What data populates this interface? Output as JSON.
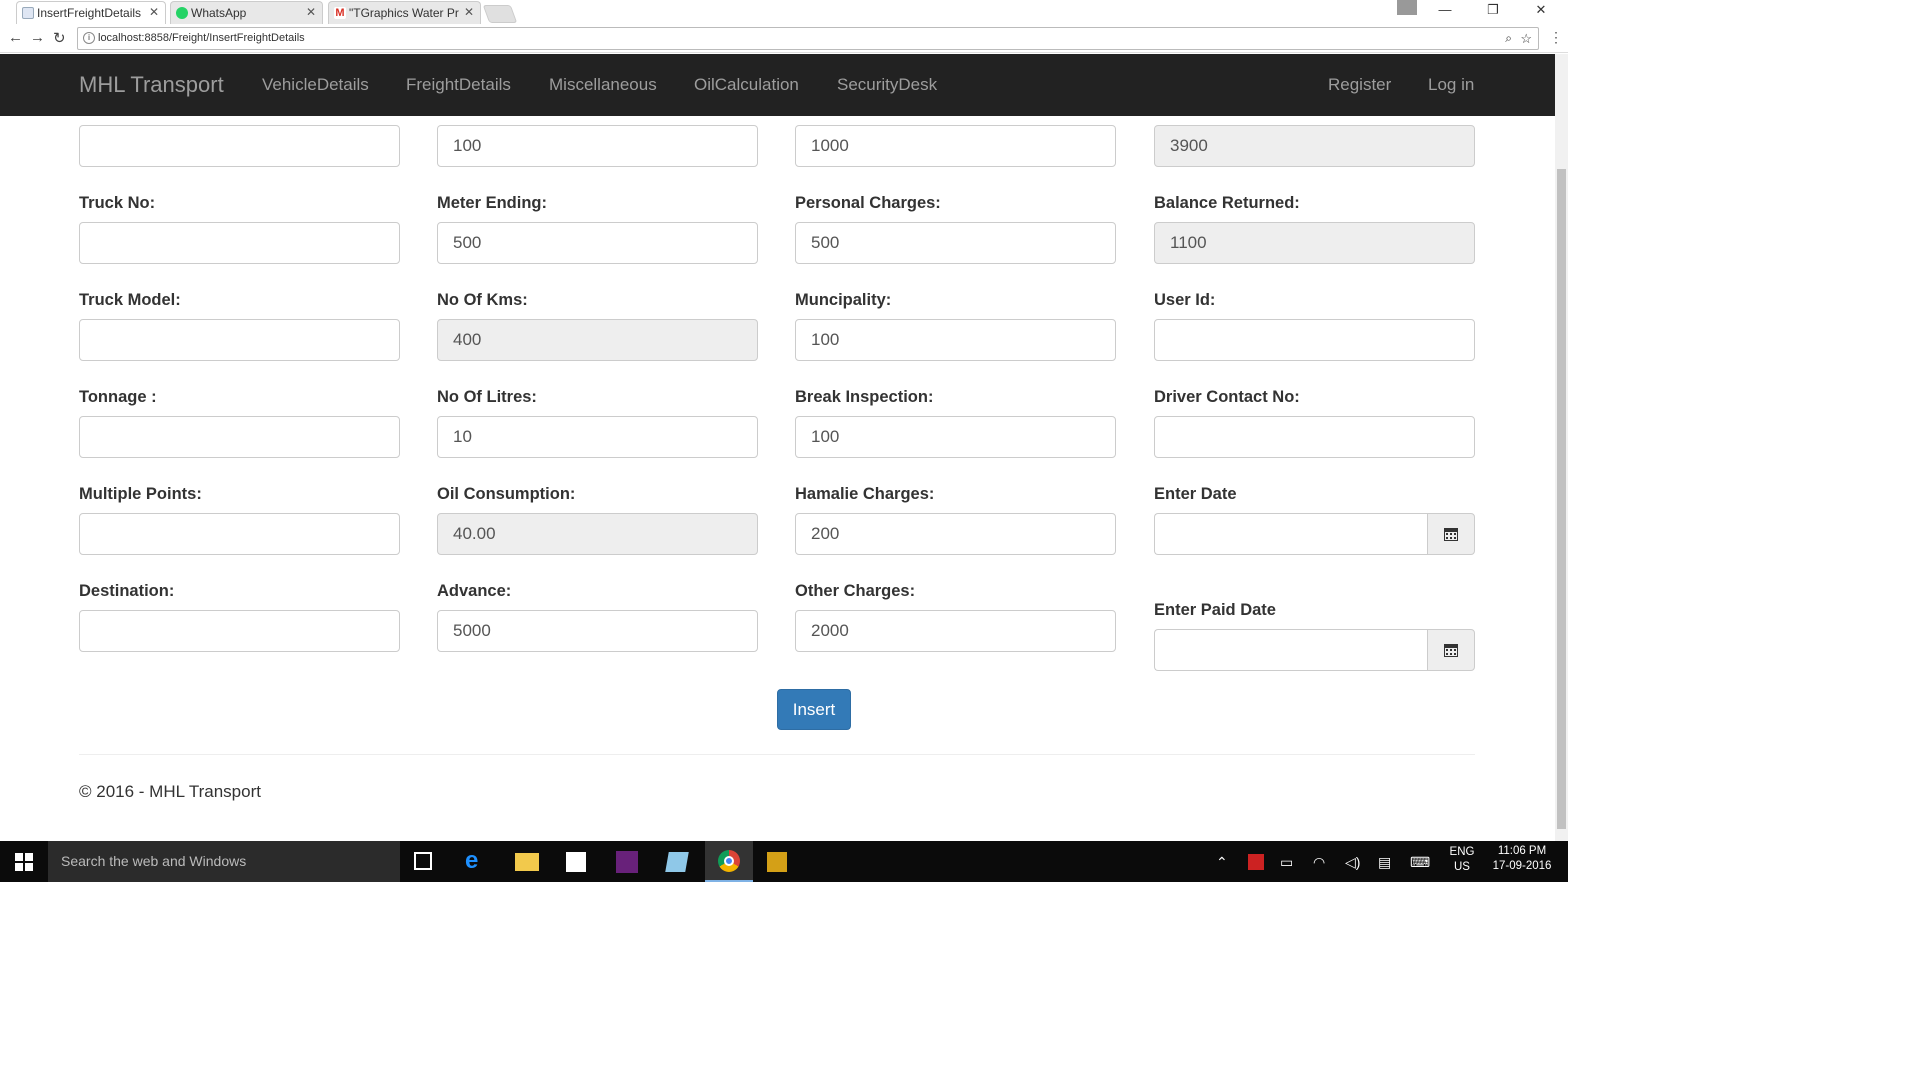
{
  "browser": {
    "tabs": [
      {
        "title": "InsertFreightDetails"
      },
      {
        "title": "WhatsApp"
      },
      {
        "title": "\"TGraphics Water Pr"
      }
    ],
    "url": "localhost:8858/Freight/InsertFreightDetails"
  },
  "navbar": {
    "brand": "MHL Transport",
    "links": [
      "VehicleDetails",
      "FreightDetails",
      "Miscellaneous",
      "OilCalculation",
      "SecurityDesk"
    ],
    "right_links": [
      "Register",
      "Log in"
    ]
  },
  "form": {
    "top_row_values": [
      "",
      "100",
      "1000",
      "3900"
    ],
    "col1": [
      {
        "label": "Truck No:",
        "value": ""
      },
      {
        "label": "Truck Model:",
        "value": ""
      },
      {
        "label": "Tonnage :",
        "value": ""
      },
      {
        "label": "Multiple Points:",
        "value": ""
      },
      {
        "label": "Destination:",
        "value": ""
      }
    ],
    "col2": [
      {
        "label": "Meter Ending:",
        "value": "500"
      },
      {
        "label": "No Of Kms:",
        "value": "400"
      },
      {
        "label": "No Of Litres:",
        "value": "10"
      },
      {
        "label": "Oil Consumption:",
        "value": "40.00"
      },
      {
        "label": "Advance:",
        "value": "5000"
      }
    ],
    "col3": [
      {
        "label": "Personal Charges:",
        "value": "500"
      },
      {
        "label": "Muncipality:",
        "value": "100"
      },
      {
        "label": "Break Inspection:",
        "value": "100"
      },
      {
        "label": "Hamalie Charges:",
        "value": "200"
      },
      {
        "label": "Other Charges:",
        "value": "2000"
      }
    ],
    "col4": [
      {
        "label": "Balance Returned:",
        "value": "1100"
      },
      {
        "label": "User Id:",
        "value": ""
      },
      {
        "label": "Driver Contact No:",
        "value": ""
      }
    ],
    "enter_date_label": "Enter Date",
    "enter_paid_date_label": "Enter Paid Date",
    "insert_label": "Insert"
  },
  "footer": {
    "text": "© 2016 - MHL Transport"
  },
  "taskbar": {
    "search_placeholder": "Search the web and Windows",
    "lang": "ENG",
    "region": "US",
    "time": "11:06 PM",
    "date": "17-09-2016"
  }
}
